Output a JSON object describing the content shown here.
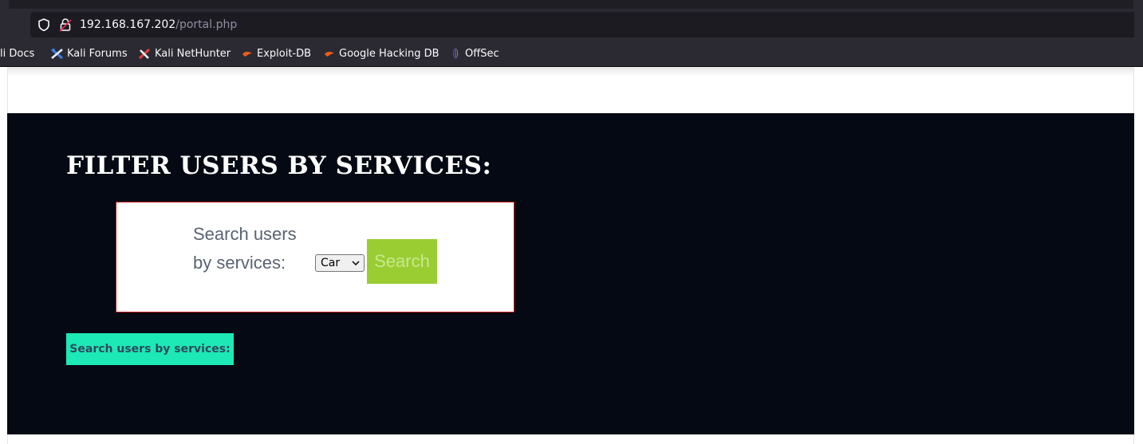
{
  "browser": {
    "url_host": "192.168.167.202",
    "url_path": "/portal.php",
    "bookmarks": [
      {
        "label": "li Docs",
        "icon": "kali-docs-icon"
      },
      {
        "label": "Kali Forums",
        "icon": "kali-forums-icon"
      },
      {
        "label": "Kali NetHunter",
        "icon": "kali-nethunter-icon"
      },
      {
        "label": "Exploit-DB",
        "icon": "exploit-db-icon"
      },
      {
        "label": "Google Hacking DB",
        "icon": "google-hacking-db-icon"
      },
      {
        "label": "OffSec",
        "icon": "offsec-icon"
      }
    ]
  },
  "page": {
    "heading": "FILTER USERS BY SERVICES:",
    "form": {
      "label_line1": "Search users",
      "label_line2": "by services:",
      "selected_service": "Car",
      "search_button": "Search"
    },
    "secondary_button": "Search users by services:"
  },
  "colors": {
    "dark_background": "#040913",
    "form_border": "#c3161c",
    "search_button": "#9acd32",
    "secondary_button": "#1de9b6"
  }
}
